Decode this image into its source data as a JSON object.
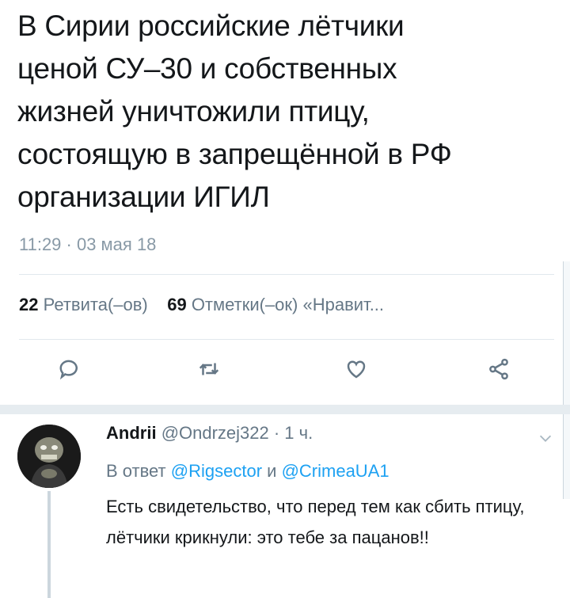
{
  "tweet": {
    "text": "В Сирии российские лётчики\nценой  СУ–30 и собственных\nжизней уничтожили птицу,\nсостоящую в запрещённой в РФ\nорганизации ИГИЛ",
    "timestamp": "11:29 · 03 мая 18",
    "retweets_count": "22",
    "retweets_label": "Ретвита(–ов)",
    "likes_count": "69",
    "likes_label": "Отметки(–ок) «Нравит..."
  },
  "actions": {
    "icons": [
      "reply-icon",
      "retweet-icon",
      "like-icon",
      "share-icon"
    ]
  },
  "reply": {
    "author_name": "Andrii",
    "handle_time": "@Ondrzej322 · 1 ч.",
    "in_reply_prefix": "В ответ",
    "mention_1": "@Rigsector",
    "and_word": "и",
    "mention_2": "@CrimeaUA1",
    "text": "Есть свидетельство, что перед тем как сбить птицу, лётчики крикнули: это тебе за пацанов!!"
  },
  "colors": {
    "text": "#14171a",
    "muted": "#657786",
    "link": "#1da1f2",
    "divider": "#e1e8ed"
  }
}
